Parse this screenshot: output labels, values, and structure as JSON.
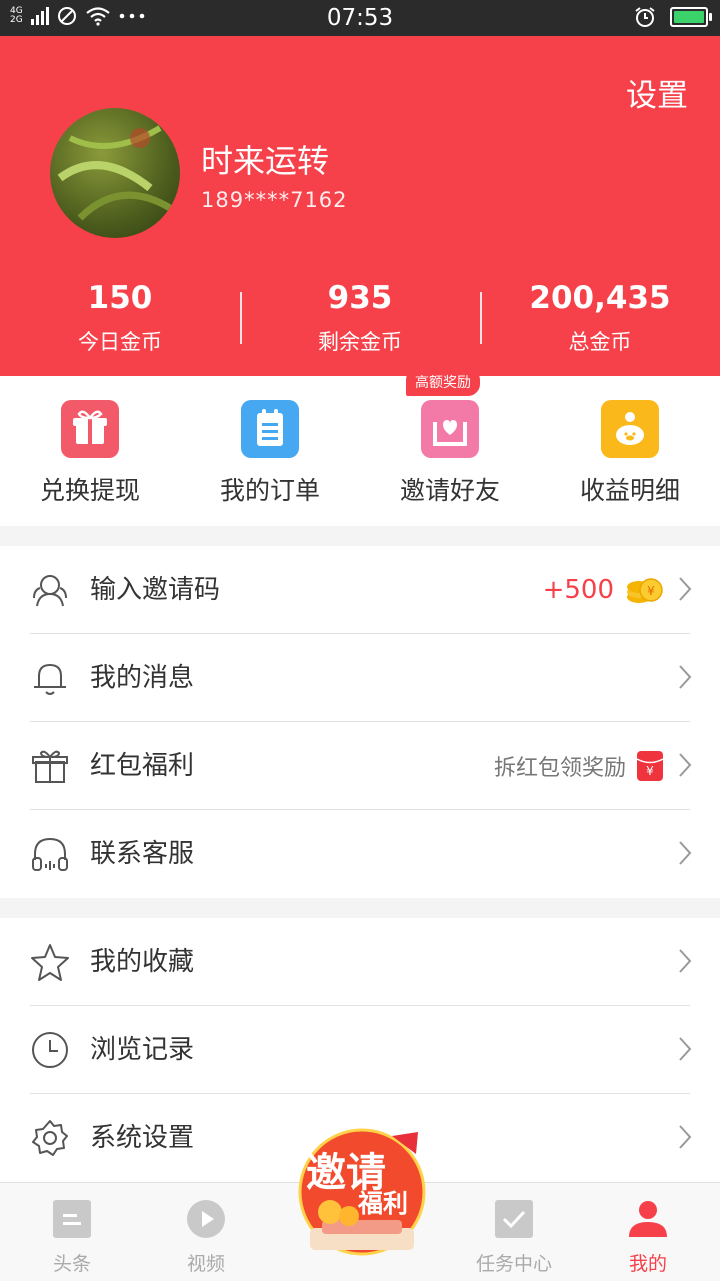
{
  "status_bar": {
    "network_top": "4G",
    "network_bottom": "2G",
    "time": "07:53"
  },
  "header": {
    "settings_label": "设置",
    "user_name": "时来运转",
    "user_phone": "189****7162",
    "stats": [
      {
        "value": "150",
        "label": "今日金币"
      },
      {
        "value": "935",
        "label": "剩余金币"
      },
      {
        "value": "200,435",
        "label": "总金币"
      }
    ]
  },
  "quick_actions": [
    {
      "label": "兑换提现",
      "icon": "gift-box-icon",
      "color": "#f25a6a"
    },
    {
      "label": "我的订单",
      "icon": "clipboard-icon",
      "color": "#45a8f0"
    },
    {
      "label": "邀请好友",
      "icon": "heart-mail-icon",
      "color": "#f37aa6",
      "badge": "高额奖励"
    },
    {
      "label": "收益明细",
      "icon": "piggy-bank-icon",
      "color": "#fbb81a"
    }
  ],
  "menu_group_1": [
    {
      "label": "输入邀请码",
      "icon": "people-icon",
      "extra": "+500"
    },
    {
      "label": "我的消息",
      "icon": "bell-icon"
    },
    {
      "label": "红包福利",
      "icon": "gift-icon",
      "extra": "拆红包领奖励"
    },
    {
      "label": "联系客服",
      "icon": "headset-icon"
    }
  ],
  "menu_group_2": [
    {
      "label": "我的收藏",
      "icon": "star-icon"
    },
    {
      "label": "浏览记录",
      "icon": "clock-icon"
    },
    {
      "label": "系统设置",
      "icon": "gear-icon"
    }
  ],
  "promo": {
    "line1": "邀请",
    "line2": "福利"
  },
  "tabbar": [
    {
      "label": "头条",
      "icon": "news-icon"
    },
    {
      "label": "视频",
      "icon": "play-icon"
    },
    {
      "label": "任务中心",
      "icon": "checkbox-icon"
    },
    {
      "label": "我的",
      "icon": "user-icon",
      "active": true
    }
  ],
  "colors": {
    "accent": "#f6414b",
    "coin": "#f5b400"
  }
}
